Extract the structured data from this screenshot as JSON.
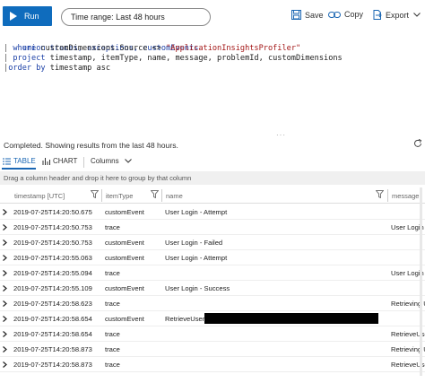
{
  "toolbar": {
    "run_label": "Run",
    "time_range_label": "Time range: Last 48 hours",
    "save_label": "Save",
    "copy_label": "Copy",
    "export_label": "Export",
    "accent_color": "#0f6cbd"
  },
  "query": {
    "line1": "union traces, exceptions, customEvents",
    "line2_kw": "where",
    "line2_field": "customDimensions.Source <> ",
    "line2_str": "\"ApplicationInsightsProfiler\"",
    "line3_kw": "project",
    "line3_rest": "timestamp, itemType, name, message, problemId, customDimensions",
    "line4_kw": "order by",
    "line4_rest": "timestamp asc"
  },
  "status_text": "Completed. Showing results from the last 48 hours.",
  "view_tabs": {
    "table_label": "TABLE",
    "chart_label": "CHART",
    "columns_label": "Columns"
  },
  "group_banner": "Drag a column header and drop it here to group by that column",
  "table": {
    "columns": [
      "timestamp [UTC]",
      "itemType",
      "name",
      "message"
    ],
    "rows": [
      {
        "timestamp": "2019-07-25T14:20:50.675",
        "itemType": "customEvent",
        "name": "User Login - Attempt",
        "message": ""
      },
      {
        "timestamp": "2019-07-25T14:20:50.753",
        "itemType": "trace",
        "name": "",
        "message": "User Login"
      },
      {
        "timestamp": "2019-07-25T14:20:50.753",
        "itemType": "customEvent",
        "name": "User Login - Failed",
        "message": ""
      },
      {
        "timestamp": "2019-07-25T14:20:55.063",
        "itemType": "customEvent",
        "name": "User Login - Attempt",
        "message": ""
      },
      {
        "timestamp": "2019-07-25T14:20:55.094",
        "itemType": "trace",
        "name": "",
        "message": "User Login"
      },
      {
        "timestamp": "2019-07-25T14:20:55.109",
        "itemType": "customEvent",
        "name": "User Login - Success",
        "message": ""
      },
      {
        "timestamp": "2019-07-25T14:20:58.623",
        "itemType": "trace",
        "name": "",
        "message": "Retrieving U"
      },
      {
        "timestamp": "2019-07-25T14:20:58.654",
        "itemType": "customEvent",
        "name": "RetrieveUser",
        "message": ""
      },
      {
        "timestamp": "2019-07-25T14:20:58.654",
        "itemType": "trace",
        "name": "",
        "message": "RetrieveUse"
      },
      {
        "timestamp": "2019-07-25T14:20:58.873",
        "itemType": "trace",
        "name": "",
        "message": "Retrieving U"
      },
      {
        "timestamp": "2019-07-25T14:20:58.873",
        "itemType": "trace",
        "name": "",
        "message": "RetrieveUse"
      }
    ]
  }
}
